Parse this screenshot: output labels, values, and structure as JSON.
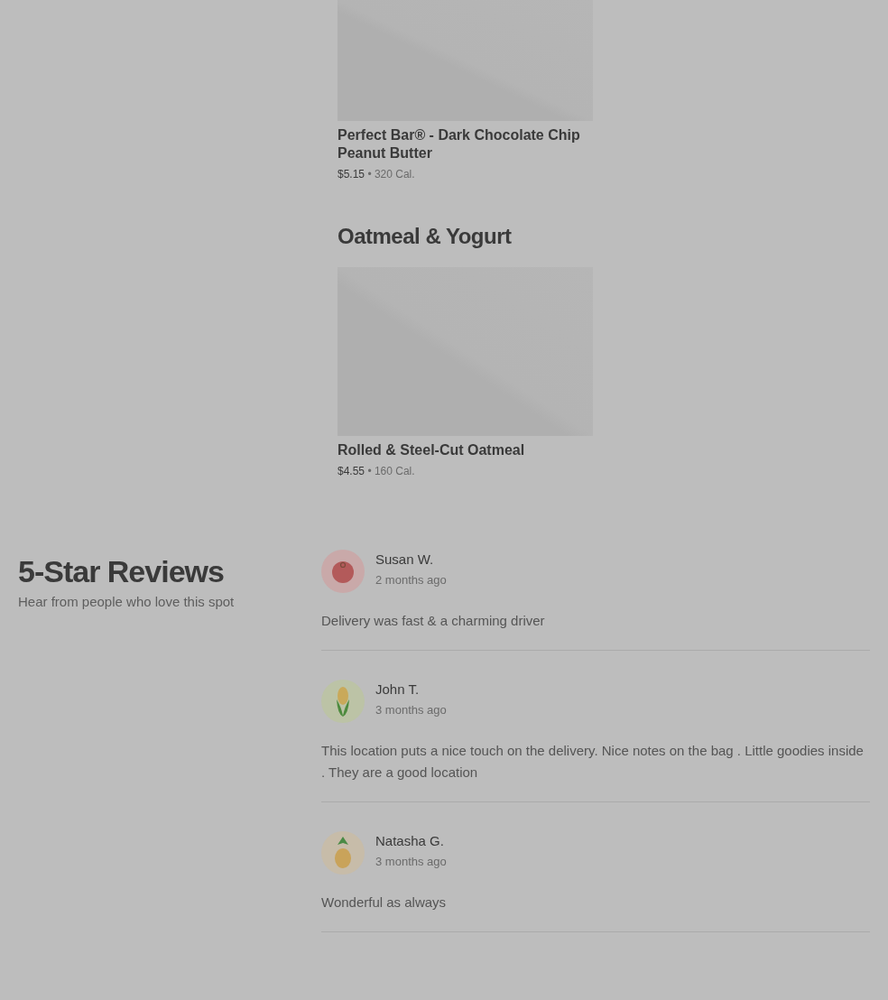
{
  "menu_sections": [
    {
      "items": [
        {
          "name": "Perfect Bar® - Dark Chocolate Chip Peanut Butter",
          "price": "$5.15",
          "separator": "•",
          "calories": "320 Cal.",
          "image": {
            "kind": "placeholder"
          }
        }
      ]
    },
    {
      "heading": "Oatmeal & Yogurt",
      "items": [
        {
          "name": "Rolled & Steel-Cut Oatmeal",
          "price": "$4.55",
          "separator": "•",
          "calories": "160 Cal.",
          "image": {
            "kind": "placeholder"
          }
        }
      ]
    }
  ],
  "reviews": {
    "title": "5-Star Reviews",
    "subtitle": "Hear from people who love this spot",
    "items": [
      {
        "name": "Susan W.",
        "time": "2 months ago",
        "text": "Delivery was fast & a charming driver",
        "avatar": {
          "kind": "tomato"
        }
      },
      {
        "name": "John T.",
        "time": "3 months ago",
        "text": "This location puts a nice touch on the delivery. Nice notes on the bag . Little goodies inside . They are a good location",
        "avatar": {
          "kind": "corn"
        }
      },
      {
        "name": "Natasha G.",
        "time": "3 months ago",
        "text": "Wonderful as always",
        "avatar": {
          "kind": "pineapple"
        }
      }
    ]
  }
}
